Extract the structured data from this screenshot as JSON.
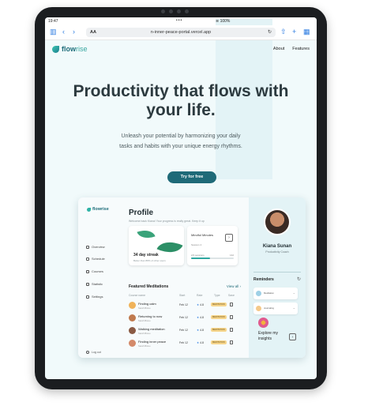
{
  "statusbar": {
    "time": "19:47",
    "dots": "•••",
    "right": "≋ 100%"
  },
  "browser": {
    "text_size": "AA",
    "url": "n-inner-peace-portal.vercel.app",
    "reload": "↻"
  },
  "site": {
    "brand_main": "flow",
    "brand_rest": "rise",
    "nav": [
      "About",
      "Features"
    ]
  },
  "hero": {
    "title": "Productivity that flows with your life.",
    "subtitle": "Unleash your potential by harmonizing your daily tasks and habits with your unique energy rhythms.",
    "cta": "Try for free"
  },
  "dashboard": {
    "brand": "flowrise",
    "sidebar": [
      "Overview",
      "Schedule",
      "Courses",
      "Statistic",
      "Settings"
    ],
    "logout": "Log out",
    "title": "Profile",
    "subtitle": "Welcome back Kiana! Your progress is really great. Keep it up",
    "streak": {
      "label": "34 day streak",
      "sub": "Better than 88% of other users"
    },
    "session": {
      "title": "Mindful Minutes",
      "sub": "Session 4",
      "progress_left": "2/4 sessions",
      "progress_right": "14d",
      "progress_fraction": 0.45
    },
    "featured": {
      "title": "Featured Meditations",
      "view_all": "View all  ›",
      "columns": [
        "Course name",
        "Start",
        "Rate",
        "Type",
        "Save"
      ],
      "rows": [
        {
          "name": "Finding calm",
          "author": "Sarah Bravo",
          "start": "Feb 12",
          "rate": "4.8",
          "type": "MEDITATION",
          "color": "#f0b35a"
        },
        {
          "name": "Returning to now",
          "author": "Sarah Bravo",
          "start": "Feb 12",
          "rate": "4.8",
          "type": "MEDITATION",
          "color": "#c07a4e"
        },
        {
          "name": "Walking meditation",
          "author": "Sarah Bravo",
          "start": "Feb 12",
          "rate": "4.8",
          "type": "MEDITATION",
          "color": "#8a5a44"
        },
        {
          "name": "Finding inner peace",
          "author": "Sarah Bravo",
          "start": "Feb 12",
          "rate": "4.8",
          "type": "MEDITATION",
          "color": "#d48a6a"
        }
      ]
    },
    "profile": {
      "name": "Kiana Sunan",
      "role": "Productivity Coach"
    },
    "reminders": {
      "title": "Reminders",
      "items": [
        {
          "text": "Meditation",
          "color": "#9ed0e6"
        },
        {
          "text": "Journaling",
          "color": "#f5c98a"
        }
      ]
    },
    "explore": "Explore my insights"
  },
  "colors": {
    "accent": "#1f6a78",
    "teal": "#2fa7a0",
    "page_bg": "#f1fafb"
  }
}
